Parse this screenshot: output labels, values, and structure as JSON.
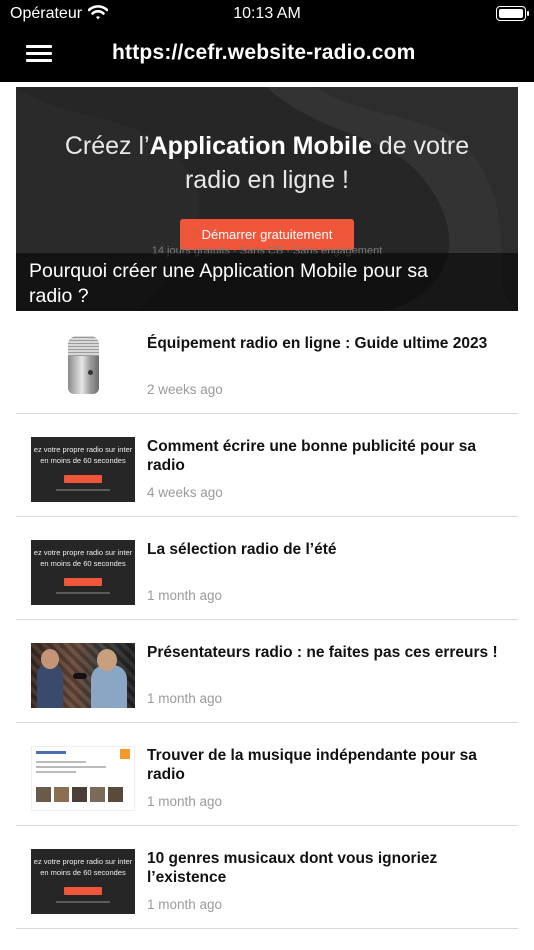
{
  "status_bar": {
    "carrier": "Opérateur",
    "time": "10:13 AM"
  },
  "nav": {
    "url": "https://cefr.website-radio.com",
    "menu_icon": "hamburger-menu-icon"
  },
  "hero": {
    "headline_part1": "Créez l’",
    "headline_bold": "Application Mobile",
    "headline_part2": " de votre",
    "headline_line2": "radio en ligne !",
    "cta_label": "Démarrer gratuitement",
    "subnote": "14 jours gratuits · Sans CB · Sans engagement",
    "caption": "Pourquoi créer une Application Mobile pour sa radio ?"
  },
  "promo_thumb": {
    "line1": "ez votre propre radio sur inter",
    "line2": "en moins de 60 secondes"
  },
  "articles": [
    {
      "title": "Équipement radio en ligne : Guide ultime 2023",
      "date": "2 weeks ago",
      "thumb": "microphone"
    },
    {
      "title": "Comment écrire une bonne publicité pour sa radio",
      "date": "4 weeks ago",
      "thumb": "promo"
    },
    {
      "title": "La sélection radio de l’été",
      "date": "1 month ago",
      "thumb": "promo"
    },
    {
      "title": "Présentateurs radio : ne faites pas ces erreurs !",
      "date": "1 month ago",
      "thumb": "studio"
    },
    {
      "title": "Trouver de la musique indépendante pour sa radio",
      "date": "1 month ago",
      "thumb": "website"
    },
    {
      "title": "10 genres musicaux dont vous ignoriez l’existence",
      "date": "1 month ago",
      "thumb": "promo"
    }
  ],
  "colors": {
    "bar_background": "#000000",
    "cta_orange": "#f0563a",
    "date_gray": "#9a9a9a"
  }
}
